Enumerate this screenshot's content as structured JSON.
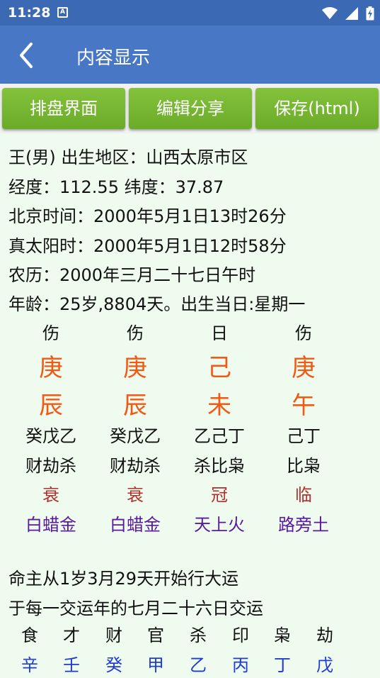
{
  "status_bar": {
    "time": "11:28",
    "notification_letter": "A"
  },
  "app_bar": {
    "title": "内容显示"
  },
  "toolbar": {
    "pan_label": "排盘界面",
    "edit_share_label": "编辑分享",
    "save_label": "保存(html)"
  },
  "info_lines": [
    "王(男) 出生地区：山西太原市区",
    "经度：112.55 纬度：37.87",
    "北京时间：2000年5月1日13时26分",
    "真太阳时：2000年5月1日12时58分",
    "农历：2000年三月二十七日午时",
    "年龄：25岁,8804天。出生当日:星期一"
  ],
  "pillars": [
    {
      "shishen": "伤",
      "gan": "庚",
      "zhi": "辰",
      "canggan": "癸戊乙",
      "cang_shishen": "财劫杀",
      "state": "衰",
      "nayin": "白蜡金"
    },
    {
      "shishen": "伤",
      "gan": "庚",
      "zhi": "辰",
      "canggan": "癸戊乙",
      "cang_shishen": "财劫杀",
      "state": "衰",
      "nayin": "白蜡金"
    },
    {
      "shishen": "日",
      "gan": "己",
      "zhi": "未",
      "canggan": "乙己丁",
      "cang_shishen": "杀比枭",
      "state": "冠",
      "nayin": "天上火"
    },
    {
      "shishen": "伤",
      "gan": "庚",
      "zhi": "午",
      "canggan": "己丁",
      "cang_shishen": "比枭",
      "state": "临",
      "nayin": "路旁土"
    }
  ],
  "dayun": {
    "start_text": "命主从1岁3月29天开始行大运",
    "jiao_text": "于每一交运年的七月二十六日交运",
    "shishen": [
      "食",
      "才",
      "财",
      "官",
      "杀",
      "印",
      "枭",
      "劫"
    ],
    "gan": [
      "辛",
      "壬",
      "癸",
      "甲",
      "乙",
      "丙",
      "丁",
      "戊"
    ]
  },
  "colors": {
    "status_bar": "#3c69b4",
    "app_bar": "#4877c5",
    "button": "#78b832",
    "background": "#eefbee",
    "pillar_gan_zhi": "#f25a14",
    "state": "#b03030",
    "nayin": "#5a1aa0",
    "dayun_gan": "#1f3bd6"
  },
  "icons": [
    "notification-a-icon",
    "wifi-icon",
    "signal-icon",
    "battery-icon",
    "back-arrow-icon"
  ]
}
